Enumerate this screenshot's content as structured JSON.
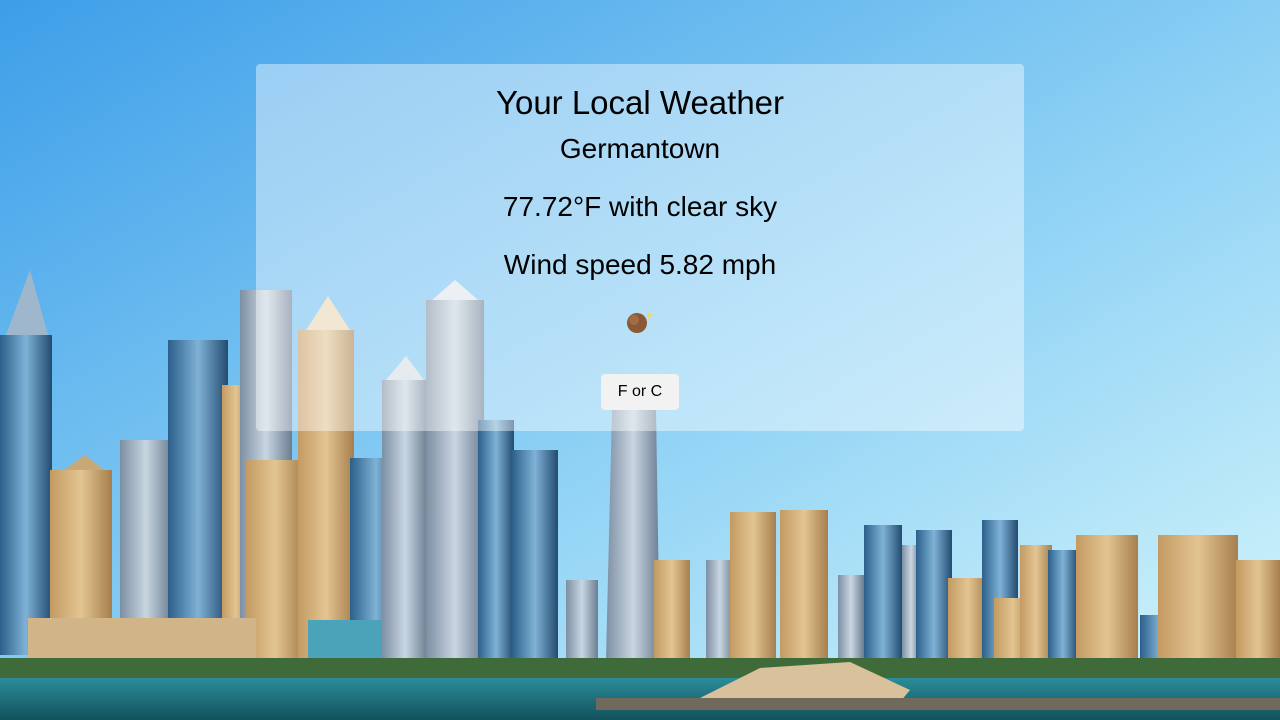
{
  "background": {
    "scene": "city-skyline-over-water",
    "sky_top": "#4ca8ec",
    "sky_bottom": "#c9f0fa",
    "sea": "#1d6e7c"
  },
  "weather": {
    "heading": "Your Local Weather",
    "city": "Germantown",
    "temperature_line": "77.72°F with clear sky",
    "wind_line": "Wind speed 5.82 mph",
    "condition_icon": "clear-sky-icon"
  },
  "controls": {
    "toggle_label": "F or C"
  }
}
